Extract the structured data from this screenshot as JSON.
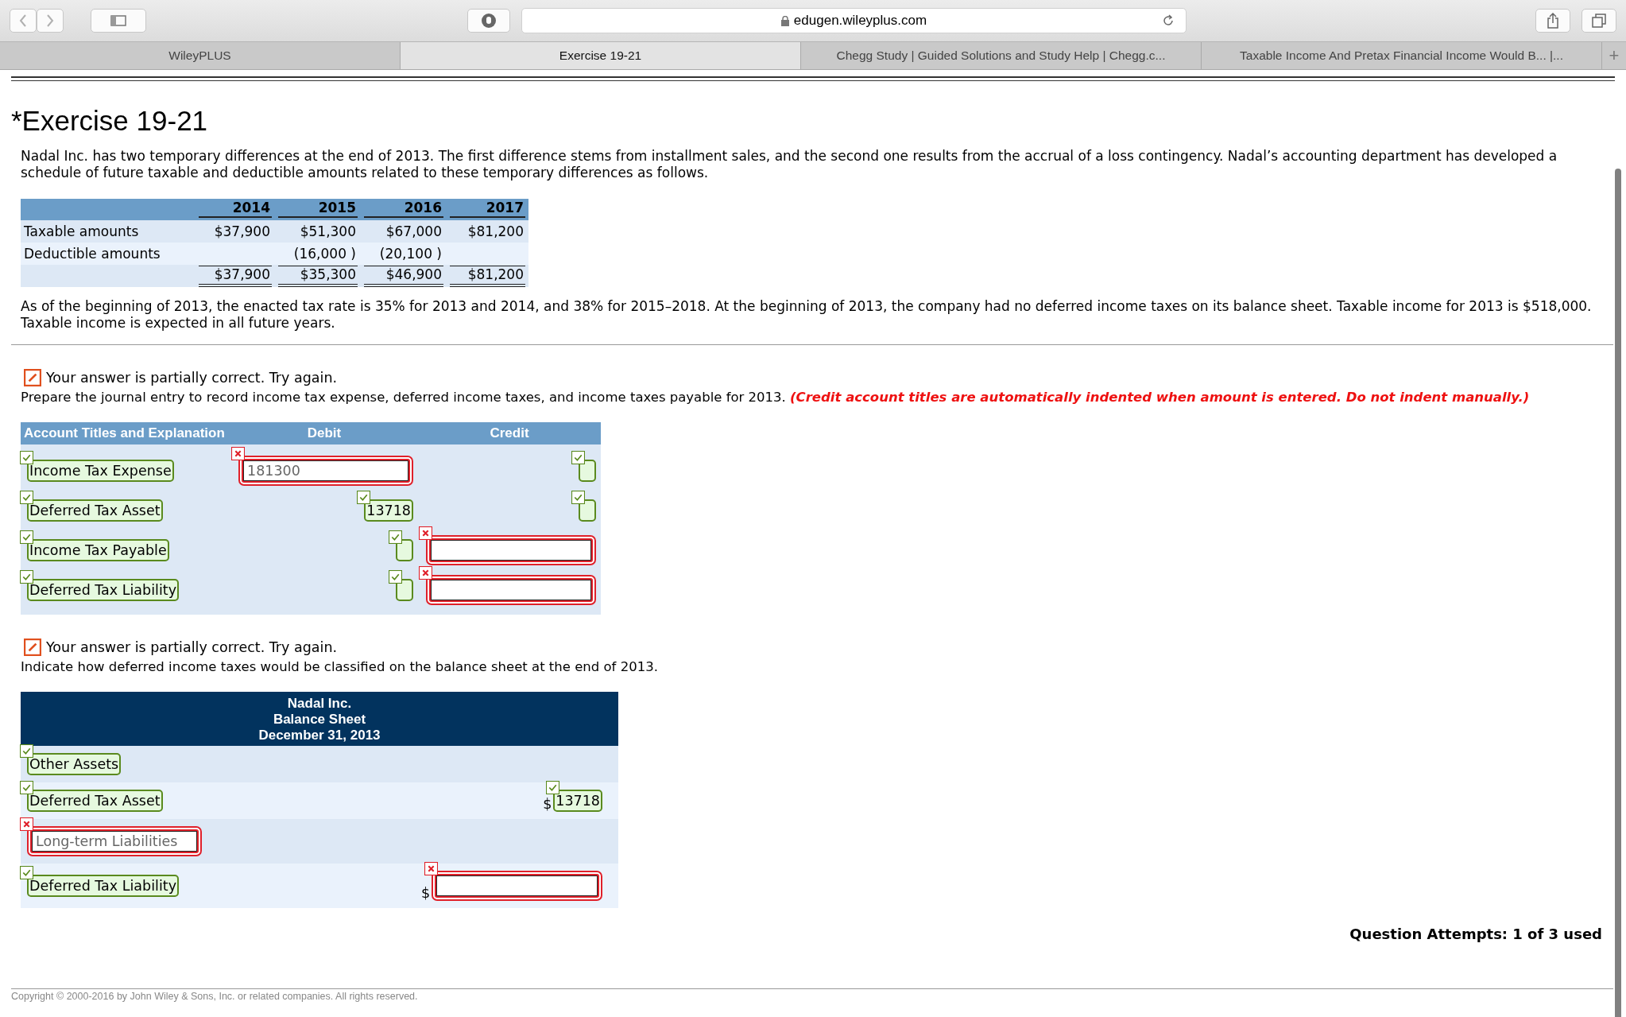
{
  "browser": {
    "url": "edugen.wileyplus.com",
    "tabs": [
      {
        "label": "WileyPLUS",
        "selected": false
      },
      {
        "label": "Exercise 19-21",
        "selected": true
      },
      {
        "label": "Chegg Study | Guided Solutions and Study Help | Chegg.c...",
        "selected": false
      },
      {
        "label": "Taxable Income And Pretax Financial Income Would B... |...",
        "selected": false
      }
    ],
    "new_tab": "+"
  },
  "title": "*Exercise 19-21",
  "intro": "Nadal Inc. has two temporary differences at the end of 2013. The first difference stems from installment sales, and the second one results from the accrual of a loss contingency. Nadal’s accounting department has developed a schedule of future taxable and deductible amounts related to these temporary differences as follows.",
  "schedule": {
    "columns": [
      "2014",
      "2015",
      "2016",
      "2017"
    ],
    "rows": [
      {
        "kind": "line",
        "label": "Taxable amounts",
        "cells": [
          "$37,900",
          "$51,300",
          "$67,000",
          "$81,200"
        ]
      },
      {
        "kind": "line",
        "label": "Deductible amounts",
        "cells": [
          "",
          "(16,000 )",
          "(20,100 )",
          ""
        ]
      },
      {
        "kind": "total",
        "label": "",
        "cells": [
          "$37,900",
          "$35,300",
          "$46,900",
          "$81,200"
        ]
      }
    ]
  },
  "note": "As of the beginning of 2013, the enacted tax rate is 35% for 2013 and 2014, and 38% for 2015–2018. At the beginning of 2013, the company had no deferred income taxes on its balance sheet. Taxable income for 2013 is $518,000. Taxable income is expected in all future years.",
  "parts": [
    {
      "kind": "journal",
      "feedback": "Your answer is partially correct.  Try again.",
      "instruction": "Prepare the journal entry to record income tax expense, deferred income taxes, and income taxes payable for 2013.",
      "instruction_note": "(Credit account titles are automatically indented when amount is entered. Do not indent manually.)",
      "columns": [
        "Account Titles and Explanation",
        "Debit",
        "Credit"
      ],
      "rows": [
        {
          "account": {
            "value": "Income Tax Expense",
            "correct": true
          },
          "debit": {
            "value": "181300",
            "correct": false
          },
          "credit": {
            "correct": true
          }
        },
        {
          "account": {
            "value": "Deferred Tax Asset",
            "correct": true
          },
          "debit": {
            "value": "13718",
            "correct": true
          },
          "credit": {
            "correct": true
          }
        },
        {
          "account": {
            "value": "Income Tax Payable",
            "correct": true
          },
          "debit": {
            "correct": true
          },
          "credit": {
            "correct": false
          }
        },
        {
          "account": {
            "value": "Deferred Tax Liability",
            "correct": true
          },
          "debit": {
            "correct": true
          },
          "credit": {
            "correct": false
          }
        }
      ]
    },
    {
      "kind": "balance_sheet",
      "feedback": "Your answer is partially correct.  Try again.",
      "instruction": "Indicate how deferred income taxes would be classified on the balance sheet at the end of 2013.",
      "heading": [
        "Nadal Inc.",
        "Balance Sheet",
        "December 31, 2013"
      ],
      "rows": [
        {
          "label": {
            "value": "Other Assets",
            "correct": true
          }
        },
        {
          "label": {
            "value": "Deferred Tax Asset",
            "correct": true
          },
          "currency": "$",
          "amount": {
            "value": "13718",
            "correct": true
          }
        },
        {
          "label": {
            "value": "Long-term Liabilities",
            "correct": false
          }
        },
        {
          "label": {
            "value": "Deferred Tax Liability",
            "correct": true
          },
          "currency": "$",
          "amount": {
            "correct": false
          }
        }
      ]
    }
  ],
  "attempts": "Question Attempts: 1 of 3 used",
  "copyright": "Copyright © 2000-2016 by John Wiley & Sons, Inc. or related companies. All rights reserved."
}
